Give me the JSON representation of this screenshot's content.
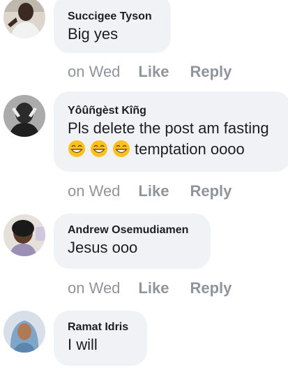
{
  "comments": [
    {
      "author": "Succigee Tyson",
      "lines": [
        "Big yes"
      ],
      "time": "on Wed",
      "like_label": "Like",
      "reply_label": "Reply",
      "avatar_icon": "user-avatar-photo"
    },
    {
      "author": "Yôûñgèst Kîñg",
      "lines": [
        "Pls delete the post am fasting",
        "temptation oooo"
      ],
      "emoji_icon": "grinning-face-emoji",
      "emoji_count": 3,
      "time": "on Wed",
      "like_label": "Like",
      "reply_label": "Reply",
      "avatar_icon": "user-avatar-photo"
    },
    {
      "author": "Andrew Osemudiamen",
      "lines": [
        "Jesus ooo"
      ],
      "time": "on Wed",
      "like_label": "Like",
      "reply_label": "Reply",
      "avatar_icon": "user-avatar-photo"
    },
    {
      "author": "Ramat Idris",
      "lines": [
        "I will"
      ],
      "avatar_icon": "user-avatar-photo"
    }
  ],
  "colors": {
    "bubble": "#f0f2f5",
    "meta_text": "#90949c",
    "name_text": "#1c1e21"
  }
}
